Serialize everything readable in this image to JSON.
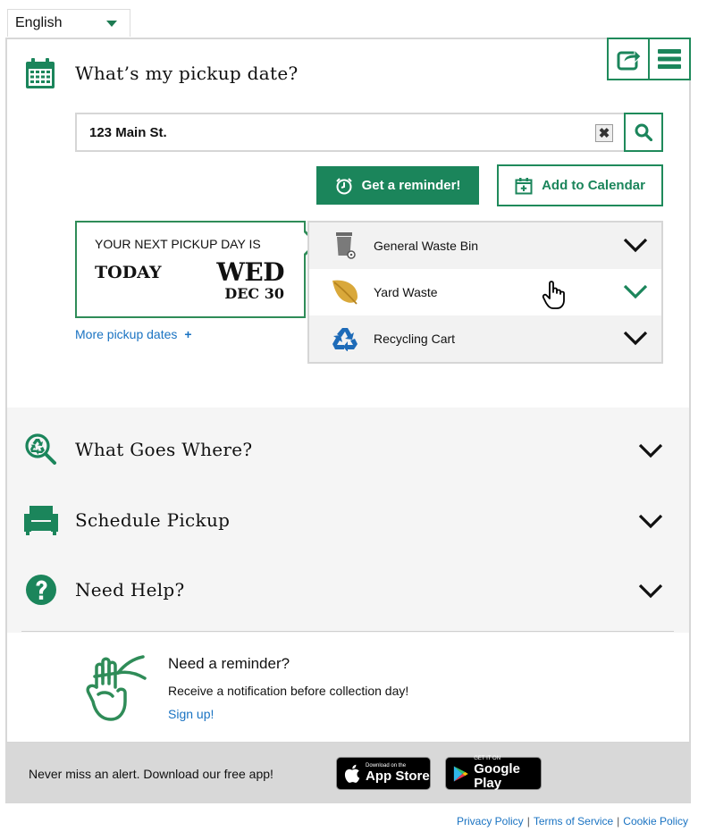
{
  "language": {
    "selected": "English"
  },
  "icons": {
    "share": "share-icon",
    "menu": "menu-icon",
    "calendar": "calendar-icon",
    "search": "search-icon",
    "clear": "clear-icon",
    "alarm": "alarm-clock-icon",
    "add_calendar": "calendar-plus-icon",
    "general_waste": "garbage-bin-icon",
    "yard_waste": "leaf-icon",
    "recycling": "recycling-icon",
    "what_goes_where": "search-recycle-icon",
    "schedule_pickup": "armchair-icon",
    "need_help": "question-icon",
    "reminder": "finger-string-icon",
    "apple": "apple-icon",
    "google_play": "play-icon"
  },
  "colors": {
    "accent": "#1b855b",
    "link": "#1a73c2",
    "yard_leaf": "#d9a83a",
    "recycle": "#1e6bb8"
  },
  "pickup": {
    "title": "What’s my pickup date?",
    "search": {
      "value": "123 Main St.",
      "clear_label": "✖"
    },
    "reminder_button": "Get a reminder!",
    "calendar_button": "Add to Calendar",
    "next": {
      "label": "YOUR NEXT PICKUP DAY IS",
      "today": "TODAY",
      "weekday": "WED",
      "date": "DEC 30"
    },
    "more_dates": "More pickup dates",
    "more_plus": "+",
    "bins": [
      {
        "label": "General Waste Bin"
      },
      {
        "label": "Yard Waste"
      },
      {
        "label": "Recycling Cart"
      }
    ]
  },
  "accordion": [
    {
      "title": "What Goes Where?"
    },
    {
      "title": "Schedule Pickup"
    },
    {
      "title": "Need Help?"
    }
  ],
  "reminder_block": {
    "title": "Need a reminder?",
    "text": "Receive a notification before collection day!",
    "link": "Sign up!"
  },
  "app_bar": {
    "text": "Never miss an alert. Download our free app!",
    "app_store": {
      "small": "Download on the",
      "big": "App Store"
    },
    "google_play": {
      "small": "GET IT ON",
      "big": "Google Play"
    }
  },
  "legal": {
    "privacy": "Privacy Policy",
    "terms": "Terms of Service",
    "cookie": "Cookie Policy",
    "separator": "|"
  }
}
